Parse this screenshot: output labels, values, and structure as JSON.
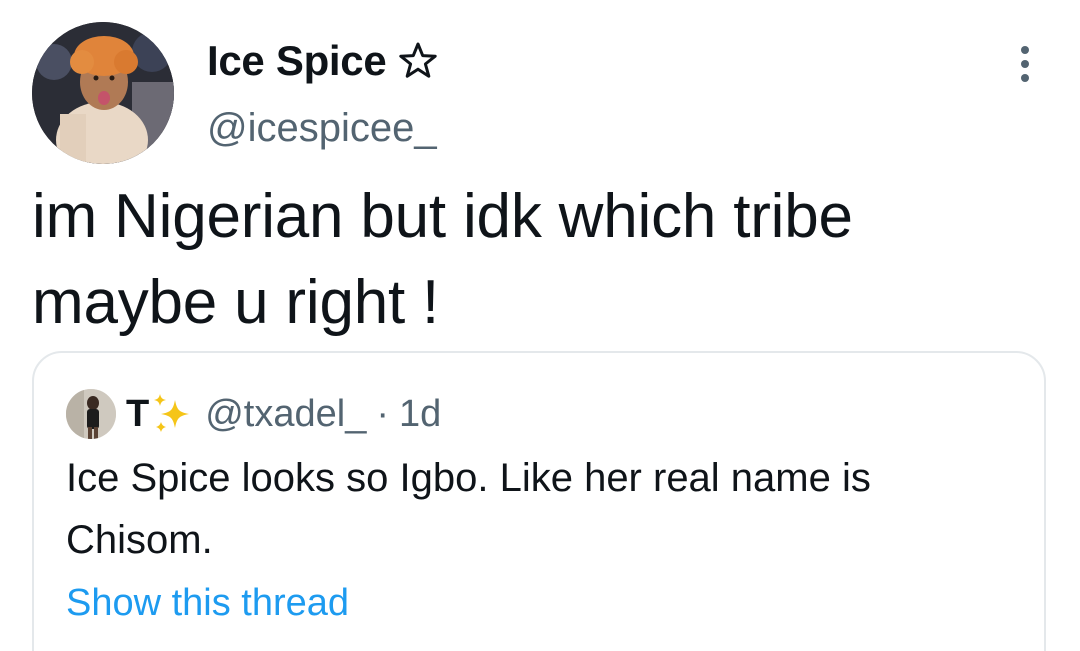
{
  "author": {
    "display_name": "Ice Spice",
    "handle": "@icespicee_",
    "badge_icon": "star-icon",
    "avatar_icon": "profile-photo"
  },
  "tweet": {
    "lines": [
      "im Nigerian but idk which tribe",
      "maybe u right !"
    ]
  },
  "menu": {
    "icon": "more-vertical-icon"
  },
  "quote": {
    "display_name": "T",
    "emoji_icon": "sparkles-icon",
    "handle": "@txadel_",
    "separator": "·",
    "time": "1d",
    "lines": [
      "Ice Spice looks so Igbo. Like her real name is",
      "Chisom."
    ],
    "show_thread_label": "Show this thread"
  },
  "colors": {
    "text_primary": "#0f1419",
    "text_secondary": "#536471",
    "link": "#1d9bf0",
    "border": "#e4e8eb",
    "sparkle": "#f5c518"
  }
}
